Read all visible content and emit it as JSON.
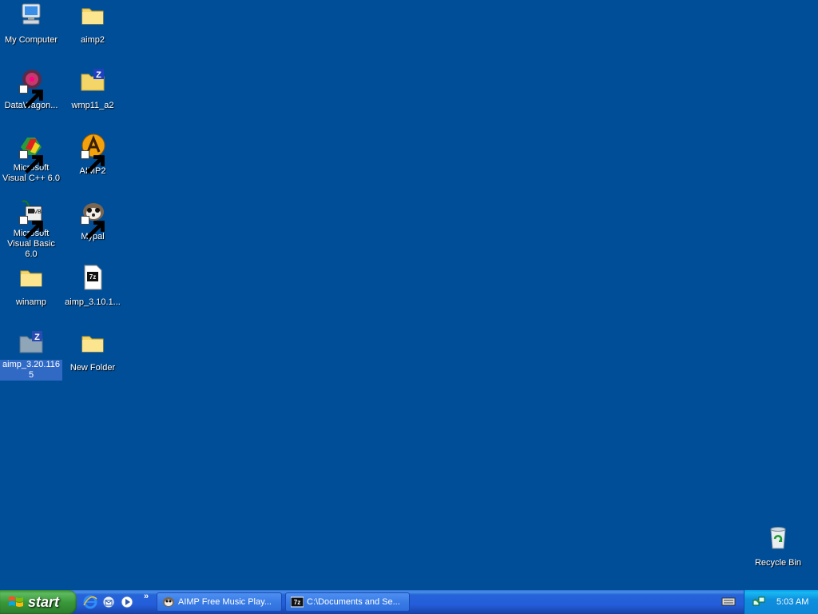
{
  "desktop": {
    "background": "#004e98",
    "icons": [
      {
        "label": "My Computer",
        "icon": "my-computer-icon"
      },
      {
        "label": "aimp2",
        "icon": "folder-icon"
      },
      {
        "label": "DataWagon...",
        "icon": "datawagon-icon"
      },
      {
        "label": "wmp11_a2",
        "icon": "zip-folder-icon"
      },
      {
        "label": "Microsoft Visual C++ 6.0",
        "icon": "visual-cpp-icon"
      },
      {
        "label": "AIMP2",
        "icon": "aimp-icon"
      },
      {
        "label": "Microsoft Visual Basic 6.0",
        "icon": "visual-basic-icon"
      },
      {
        "label": "Mypal",
        "icon": "mypal-icon"
      },
      {
        "label": "winamp",
        "icon": "folder-icon"
      },
      {
        "label": "aimp_3.10.1...",
        "icon": "7z-archive-icon"
      },
      {
        "label": "aimp_3.20.1165",
        "icon": "zip-folder-icon"
      },
      {
        "label": "New Folder",
        "icon": "folder-icon"
      },
      {
        "label": "Recycle Bin",
        "icon": "recycle-bin-icon"
      }
    ]
  },
  "taskbar": {
    "start_label": "start",
    "quick_launch": [
      "internet-explorer-icon",
      "outlook-express-icon",
      "media-player-icon"
    ],
    "quick_launch_more": "»",
    "tasks": [
      {
        "label": "AIMP Free Music Play...",
        "icon": "aimp-task-icon"
      },
      {
        "label": "C:\\Documents and Se...",
        "icon": "7z-task-icon"
      }
    ],
    "clock": "5:03 AM"
  }
}
